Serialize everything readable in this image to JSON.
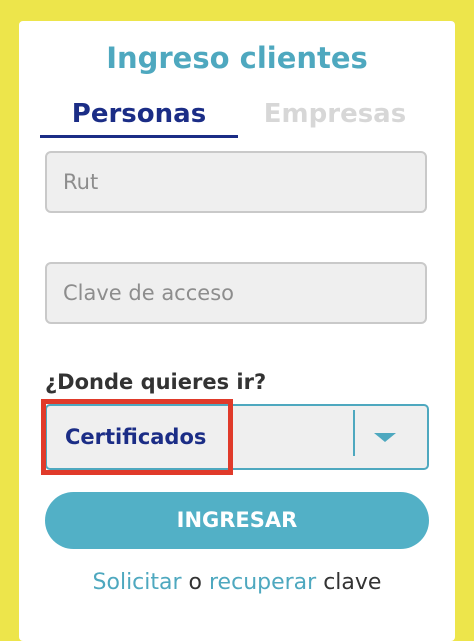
{
  "login": {
    "title": "Ingreso clientes",
    "tabs": [
      {
        "label": "Personas",
        "active": true
      },
      {
        "label": "Empresas",
        "active": false
      }
    ],
    "rut_placeholder": "Rut",
    "password_placeholder": "Clave de acceso",
    "destination_label": "¿Donde quieres ir?",
    "destination_value": "Certificados",
    "submit_label": "INGRESAR",
    "footer": {
      "link_request": "Solicitar",
      "connector": " o ",
      "link_recover": "recuperar",
      "suffix": " clave"
    }
  },
  "colors": {
    "background": "#ede54b",
    "accent": "#4ea8bf",
    "tab_active": "#1b2d86",
    "highlight": "#e03a2a"
  },
  "icons": {
    "select_arrow": "chevron-down-icon"
  }
}
